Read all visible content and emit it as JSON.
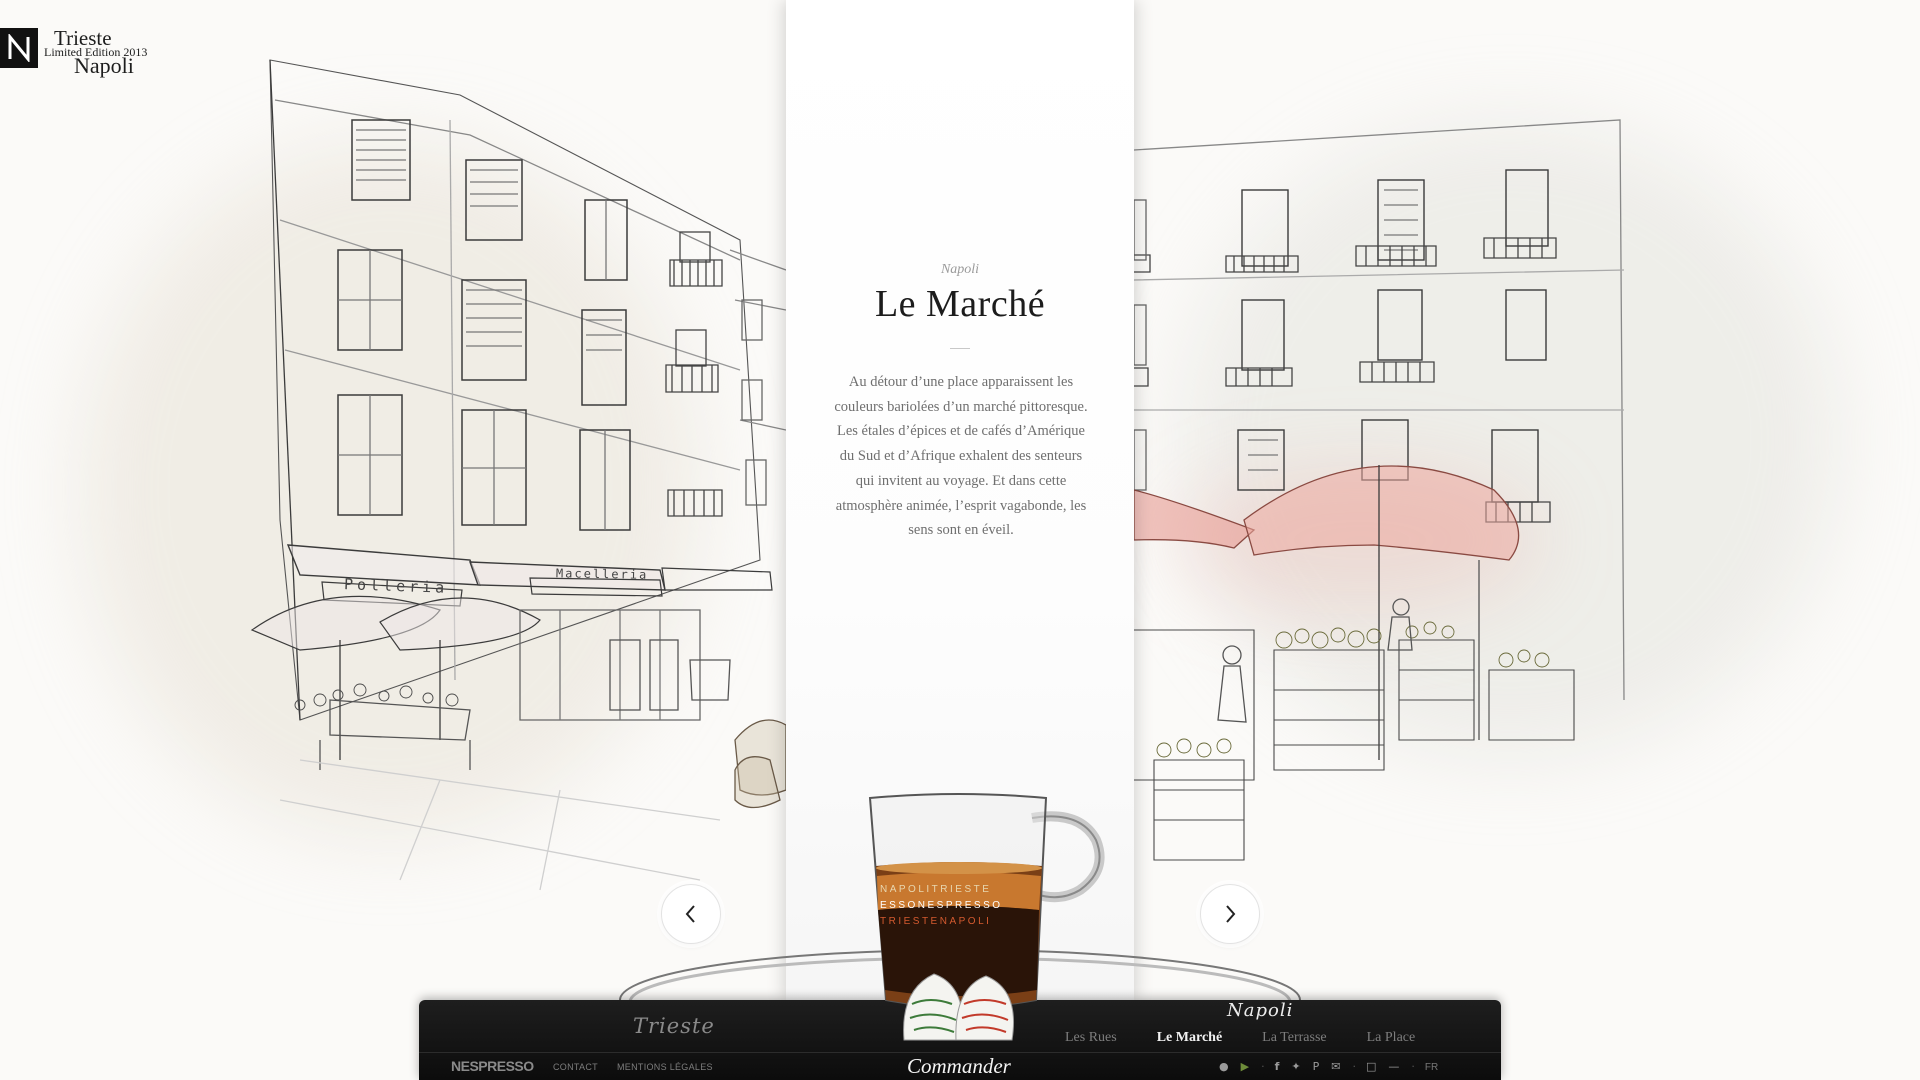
{
  "logo": {
    "line1": "Trieste",
    "line2": "Limited Edition 2013",
    "line3": "Napoli"
  },
  "card": {
    "kicker": "Napoli",
    "title": "Le Marché",
    "body": "Au détour d’une place apparaissent les couleurs bariolées d’un marché pittoresque. Les étales d’épices et de cafés d’Amérique du Sud et d’Afrique exhalent des senteurs qui invitent au voyage. Et dans cette atmosphère animée, l’esprit vagabonde, les sens sont en éveil."
  },
  "sketch_signs": {
    "left_awning": "Polleria",
    "center_awning": "Macelleria"
  },
  "cup_band": {
    "row1": "NAPOLITRIESTE",
    "row2": "ESSONESPRESSO",
    "row3": "TRIESTENAPOLI"
  },
  "footer": {
    "trieste_label": "Trieste",
    "napoli_label": "Napoli",
    "tabs": [
      "Les Rues",
      "Le Marché",
      "La Terrasse",
      "La Place"
    ],
    "active_tab": "Le Marché",
    "brand": "NESPRESSO",
    "contact": "CONTACT",
    "legal": "MENTIONS LÉGALES",
    "commander": "Commander",
    "lang": "FR"
  },
  "colors": {
    "awning_pink": "#e8a39a",
    "bar_dark": "#111111",
    "card_white": "#ffffff"
  },
  "icons": [
    "apple-icon",
    "play-icon",
    "facebook-icon",
    "twitter-icon",
    "pinterest-icon",
    "mail-icon",
    "fullscreen-icon",
    "minimize-icon"
  ]
}
